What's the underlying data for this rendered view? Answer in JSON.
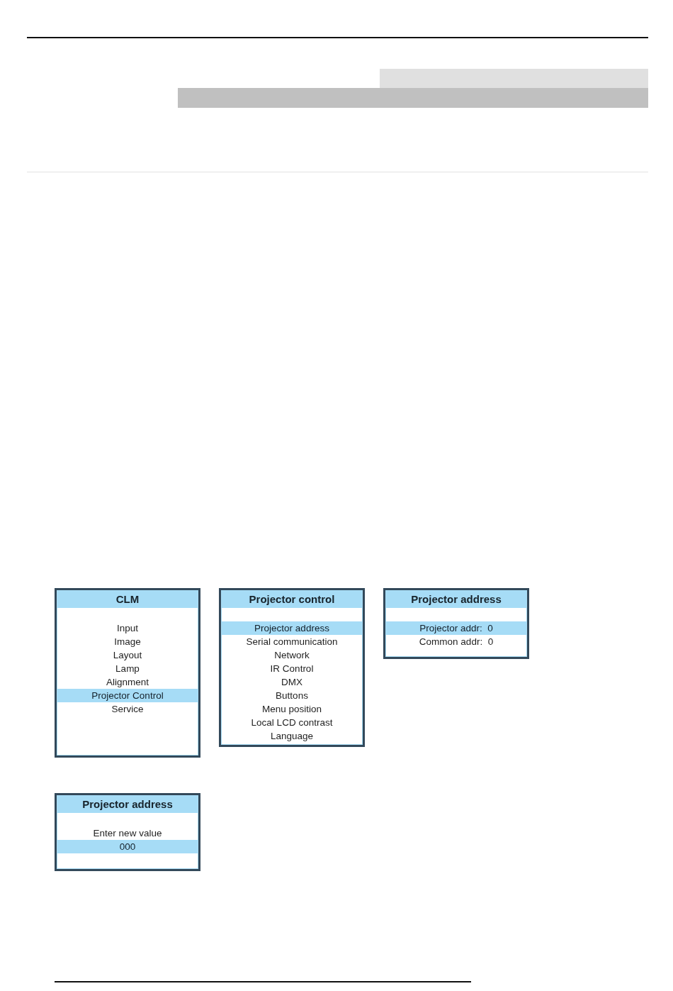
{
  "menus": [
    {
      "title": "CLM",
      "items": [
        {
          "label": "Input",
          "selected": false
        },
        {
          "label": "Image",
          "selected": false
        },
        {
          "label": "Layout",
          "selected": false
        },
        {
          "label": "Lamp",
          "selected": false
        },
        {
          "label": "Alignment",
          "selected": false
        },
        {
          "label": "Projector Control",
          "selected": true
        },
        {
          "label": "Service",
          "selected": false
        }
      ]
    },
    {
      "title": "Projector control",
      "items": [
        {
          "label": "Projector address",
          "selected": true
        },
        {
          "label": "Serial communication",
          "selected": false
        },
        {
          "label": "Network",
          "selected": false
        },
        {
          "label": "IR Control",
          "selected": false
        },
        {
          "label": "DMX",
          "selected": false
        },
        {
          "label": "Buttons",
          "selected": false
        },
        {
          "label": "Menu position",
          "selected": false
        },
        {
          "label": "Local LCD contrast",
          "selected": false
        },
        {
          "label": "Language",
          "selected": false
        }
      ]
    },
    {
      "title": "Projector address",
      "items": [
        {
          "label": "Projector addr:  0",
          "selected": true
        },
        {
          "label": "Common addr:  0",
          "selected": false
        }
      ]
    },
    {
      "title": "Projector address",
      "items": [
        {
          "label": "Enter new value",
          "selected": false
        },
        {
          "label": "000",
          "selected": true
        }
      ]
    }
  ]
}
